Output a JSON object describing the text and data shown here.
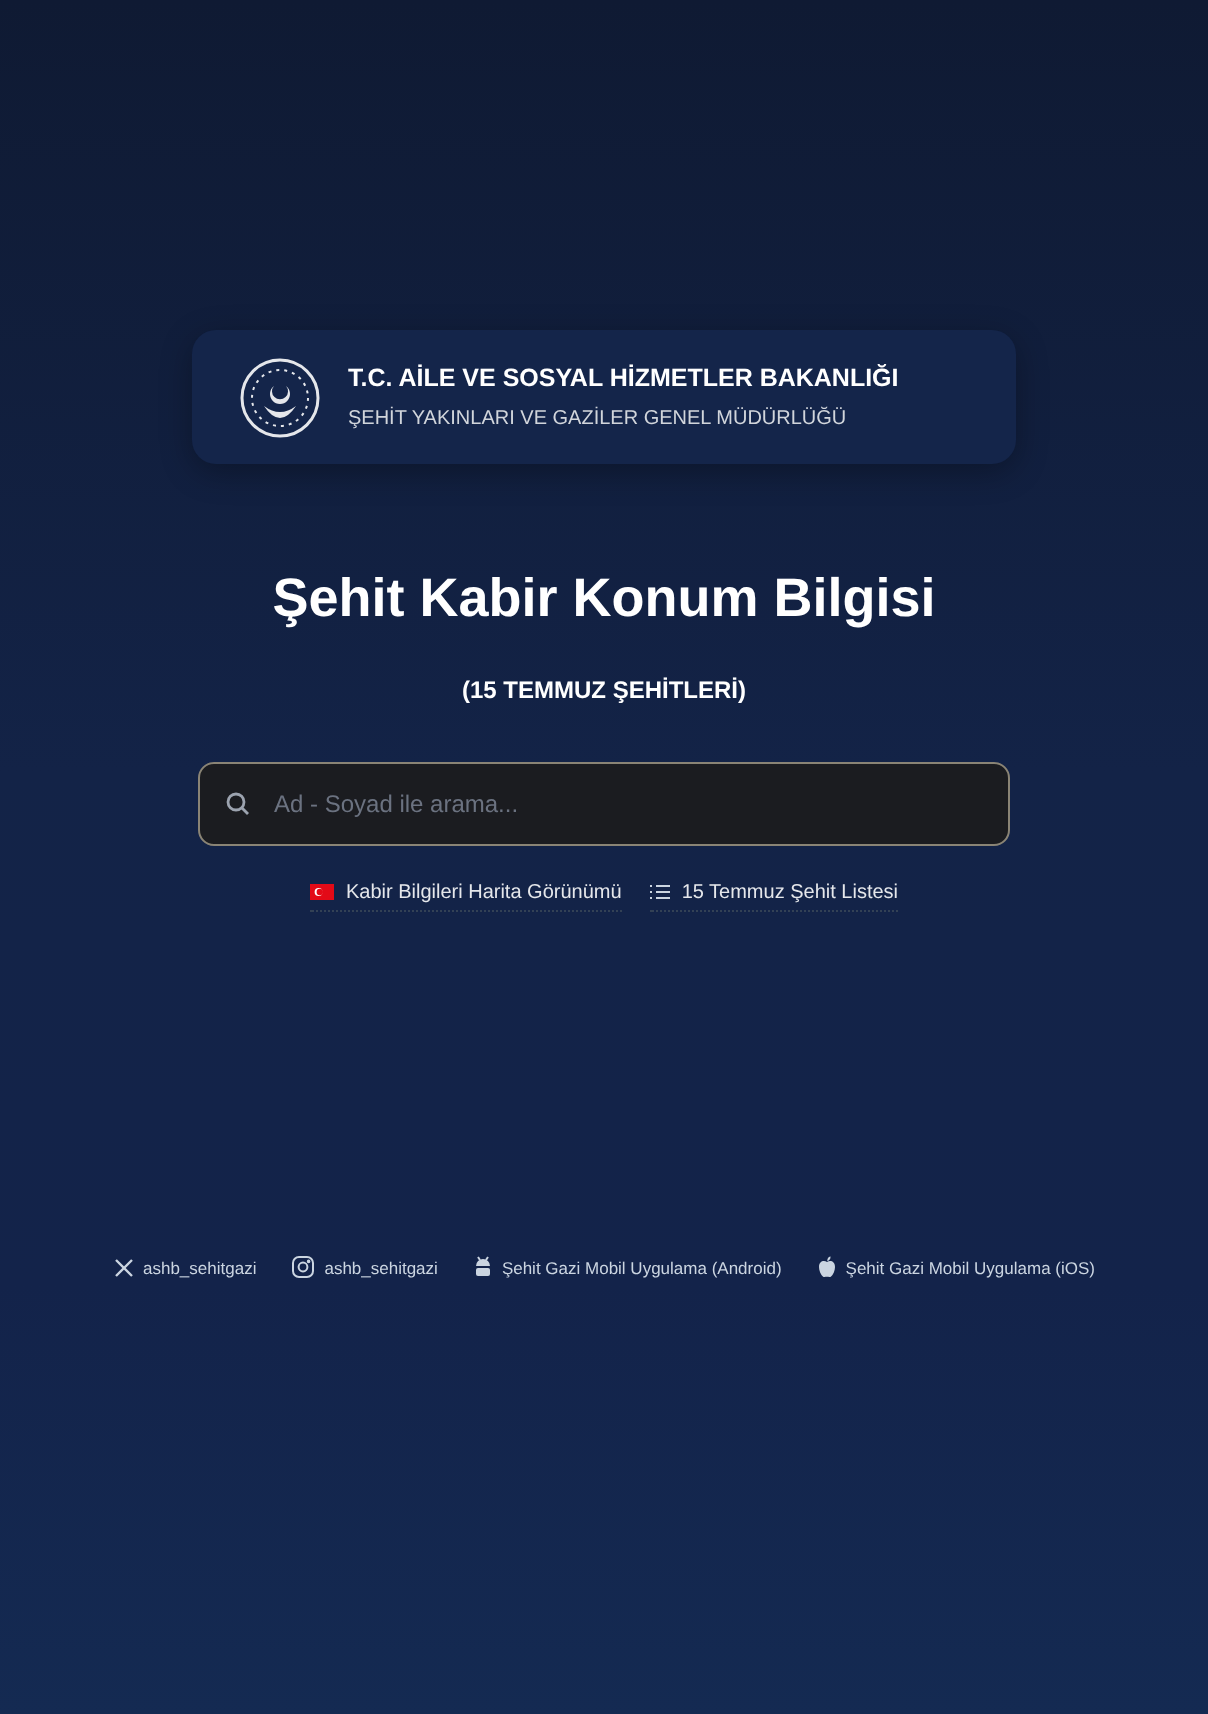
{
  "header": {
    "title": "T.C. AİLE VE SOSYAL HİZMETLER BAKANLIĞI",
    "subtitle": "ŞEHİT YAKINLARI VE GAZİLER GENEL MÜDÜRLÜĞÜ"
  },
  "page_title": "Şehit Kabir Konum Bilgisi",
  "page_subtitle": "(15 TEMMUZ ŞEHİTLERİ)",
  "search": {
    "placeholder": "Ad - Soyad ile arama..."
  },
  "links": [
    {
      "kind": "flag",
      "label": "Kabir Bilgileri Harita Görünümü"
    },
    {
      "kind": "list",
      "label": "15 Temmuz Şehit Listesi"
    }
  ],
  "footer": [
    {
      "kind": "x",
      "label": "ashb_sehitgazi"
    },
    {
      "kind": "instagram",
      "label": "ashb_sehitgazi"
    },
    {
      "kind": "android",
      "label": "Şehit Gazi Mobil Uygulama (Android)"
    },
    {
      "kind": "apple",
      "label": "Şehit Gazi Mobil Uygulama (iOS)"
    }
  ]
}
